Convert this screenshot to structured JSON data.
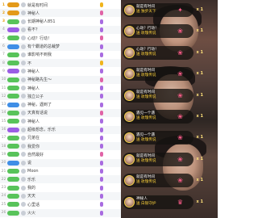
{
  "ranking": {
    "rows": [
      {
        "rank": "1",
        "level": "",
        "name": "就是有时间",
        "badge": "",
        "contrib": ""
      },
      {
        "rank": "2",
        "level": "",
        "name": "神秘人",
        "badge": "",
        "contrib": ""
      },
      {
        "rank": "3",
        "level": "",
        "name": "长期神秘人851",
        "badge": "",
        "contrib": ""
      },
      {
        "rank": "4",
        "level": "",
        "name": "看不？",
        "badge": "",
        "contrib": ""
      },
      {
        "rank": "5",
        "level": "",
        "name": "心动？行动！",
        "badge": "",
        "contrib": ""
      },
      {
        "rank": "6",
        "level": "",
        "name": "有个霸道的总裁梦",
        "badge": "",
        "contrib": ""
      },
      {
        "rank": "7",
        "level": "",
        "name": "谁影响不到我",
        "badge": "",
        "contrib": ""
      },
      {
        "rank": "8",
        "level": "",
        "name": "不",
        "badge": "",
        "contrib": ""
      },
      {
        "rank": "9",
        "level": "",
        "name": "神秘人",
        "badge": "",
        "contrib": ""
      },
      {
        "rank": "10",
        "level": "",
        "name": "神秘路先生～",
        "badge": "",
        "contrib": ""
      },
      {
        "rank": "11",
        "level": "",
        "name": "神秘人",
        "badge": "",
        "contrib": ""
      },
      {
        "rank": "12",
        "level": "",
        "name": "独立公子",
        "badge": "",
        "contrib": ""
      },
      {
        "rank": "13",
        "level": "",
        "name": "神秘，遇到了",
        "badge": "",
        "contrib": ""
      },
      {
        "rank": "14",
        "level": "",
        "name": "天真有话说",
        "badge": "",
        "contrib": ""
      },
      {
        "rank": "15",
        "level": "",
        "name": "神秘人",
        "badge": "",
        "contrib": ""
      },
      {
        "rank": "16",
        "level": "",
        "name": "超级想念，乐乐",
        "badge": "",
        "contrib": ""
      },
      {
        "rank": "17",
        "level": "",
        "name": "兄弟在",
        "badge": "",
        "contrib": ""
      },
      {
        "rank": "18",
        "level": "",
        "name": "我爱你",
        "badge": "",
        "contrib": ""
      },
      {
        "rank": "19",
        "level": "",
        "name": "自然最好",
        "badge": "",
        "contrib": ""
      },
      {
        "rank": "20",
        "level": "",
        "name": "说",
        "badge": "",
        "contrib": ""
      },
      {
        "rank": "21",
        "level": "",
        "name": "Moon",
        "badge": "",
        "contrib": ""
      },
      {
        "rank": "22",
        "level": "",
        "name": "乐乐",
        "badge": "",
        "contrib": ""
      },
      {
        "rank": "23",
        "level": "",
        "name": "我的",
        "badge": "",
        "contrib": ""
      },
      {
        "rank": "24",
        "level": "",
        "name": "天天",
        "badge": "",
        "contrib": ""
      },
      {
        "rank": "25",
        "level": "",
        "name": "心里话",
        "badge": "",
        "contrib": ""
      },
      {
        "rank": "26",
        "level": "",
        "name": "火火",
        "badge": "",
        "contrib": ""
      }
    ]
  },
  "stream": {
    "gifts": [
      {
        "sender": "就是有时间",
        "action": "送 独步天下",
        "count": "x 1"
      },
      {
        "sender": "心动？行动！",
        "action": "送 玫瑰传说",
        "count": "x 1"
      },
      {
        "sender": "心动？行动！",
        "action": "送 玫瑰传说",
        "count": "x 1"
      },
      {
        "sender": "就是有时间",
        "action": "送 玫瑰传说",
        "count": "x 1"
      },
      {
        "sender": "就是有时间",
        "action": "送 玫瑰传说",
        "count": "x 1"
      },
      {
        "sender": "遇见一个遇",
        "action": "送 玫瑰传说",
        "count": "x 1"
      },
      {
        "sender": "遇见一个遇",
        "action": "送 玫瑰传说",
        "count": "x 1"
      },
      {
        "sender": "就是有时间",
        "action": "送 玫瑰传说",
        "count": "x 1"
      },
      {
        "sender": "就是有时间",
        "action": "送 玫瑰传说",
        "count": "x 1"
      },
      {
        "sender": "神秘人",
        "action": "送 白银守护",
        "count": "x 1"
      }
    ]
  }
}
